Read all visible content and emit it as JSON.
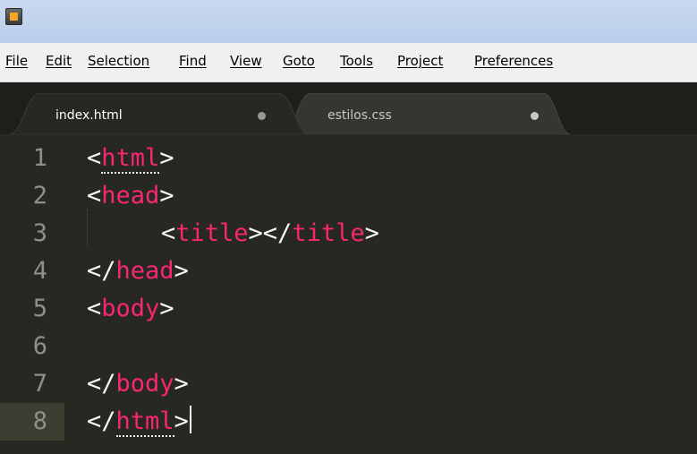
{
  "window": {
    "icon": "sublime-text-icon"
  },
  "menu": [
    {
      "label": "File"
    },
    {
      "label": "Edit"
    },
    {
      "label": "Selection"
    },
    {
      "label": "Find"
    },
    {
      "label": "View"
    },
    {
      "label": "Goto"
    },
    {
      "label": "Tools"
    },
    {
      "label": "Project"
    },
    {
      "label": "Preferences"
    }
  ],
  "tabs": [
    {
      "label": "index.html",
      "active": true,
      "dirty_indicator": "dot"
    },
    {
      "label": "estilos.css",
      "active": false,
      "dirty_indicator": "dot"
    }
  ],
  "editor": {
    "current_line": 8,
    "lines": [
      {
        "num": "1",
        "parts": [
          "<",
          "html",
          ">"
        ]
      },
      {
        "num": "2",
        "parts": [
          "<",
          "head",
          ">"
        ]
      },
      {
        "num": "3",
        "parts": [
          "<",
          "title",
          "></",
          "title",
          ">"
        ]
      },
      {
        "num": "4",
        "parts": [
          "</",
          "head",
          ">"
        ]
      },
      {
        "num": "5",
        "parts": [
          "<",
          "body",
          ">"
        ]
      },
      {
        "num": "6",
        "parts": []
      },
      {
        "num": "7",
        "parts": [
          "</",
          "body",
          ">"
        ]
      },
      {
        "num": "8",
        "parts": [
          "</",
          "html",
          ">"
        ]
      }
    ]
  },
  "colors": {
    "background": "#272822",
    "tag": "#f92672",
    "punctuation": "#f8f8f2",
    "gutter_text": "#8f908a",
    "current_line_gutter": "#3e3d32"
  }
}
